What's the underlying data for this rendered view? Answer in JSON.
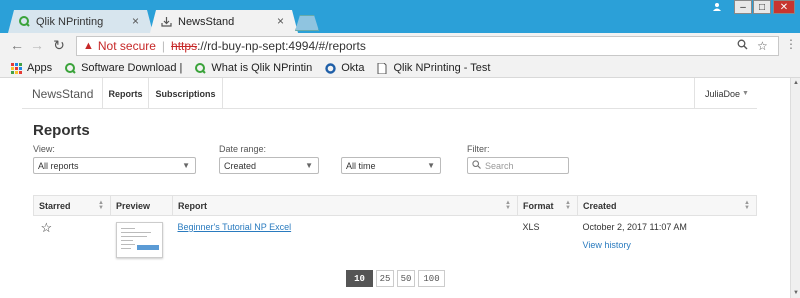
{
  "browser": {
    "tabs": [
      {
        "title": "Qlik NPrinting",
        "active": false
      },
      {
        "title": "NewsStand",
        "active": true
      }
    ],
    "address": {
      "security_label": "Not secure",
      "url_scheme": "https",
      "url_rest": "://rd-buy-np-sept:4994/#/reports"
    },
    "bookmarks": [
      "Apps",
      "Software Download |",
      "What is Qlik NPrintin",
      "Okta",
      "Qlik NPrinting - Test"
    ]
  },
  "app": {
    "brand": "NewsStand",
    "nav": [
      "Reports",
      "Subscriptions"
    ],
    "user": "JuliaDoe"
  },
  "page": {
    "title": "Reports",
    "filters": {
      "view_label": "View:",
      "view_value": "All reports",
      "date_label": "Date range:",
      "date_field": "Created",
      "date_period": "All time",
      "filter_label": "Filter:",
      "search_placeholder": "Search"
    },
    "table": {
      "headers": [
        "Starred",
        "Preview",
        "Report",
        "Format",
        "Created"
      ],
      "rows": [
        {
          "report": "Beginner's Tutorial NP Excel",
          "format": "XLS",
          "created": "October 2, 2017 11:07 AM",
          "history": "View history"
        }
      ]
    },
    "page_sizes": [
      "10",
      "25",
      "50",
      "100"
    ],
    "selected_page_size": "10"
  },
  "colors": {
    "chrome": "#2ba0d8",
    "link": "#2a7bbf",
    "warning": "#c62828"
  }
}
